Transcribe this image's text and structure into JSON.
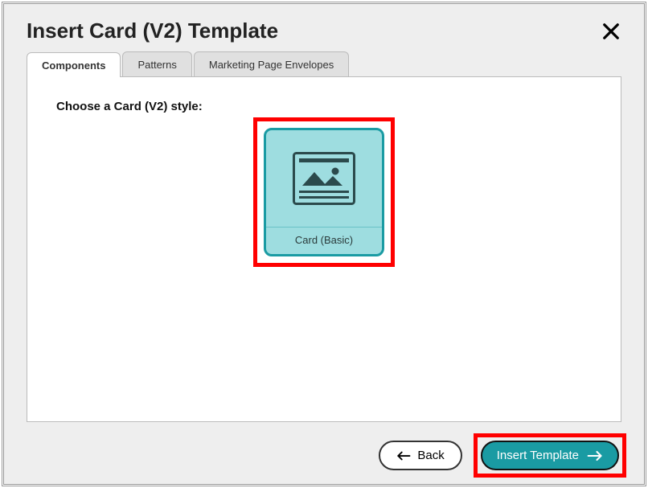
{
  "dialog": {
    "title": "Insert Card (V2) Template"
  },
  "tabs": [
    {
      "label": "Components",
      "active": true
    },
    {
      "label": "Patterns",
      "active": false
    },
    {
      "label": "Marketing Page Envelopes",
      "active": false
    }
  ],
  "content": {
    "heading": "Choose a Card (V2) style:",
    "styles": [
      {
        "label": "Card (Basic)",
        "selected": true
      }
    ]
  },
  "footer": {
    "back_label": "Back",
    "insert_label": "Insert Template"
  }
}
